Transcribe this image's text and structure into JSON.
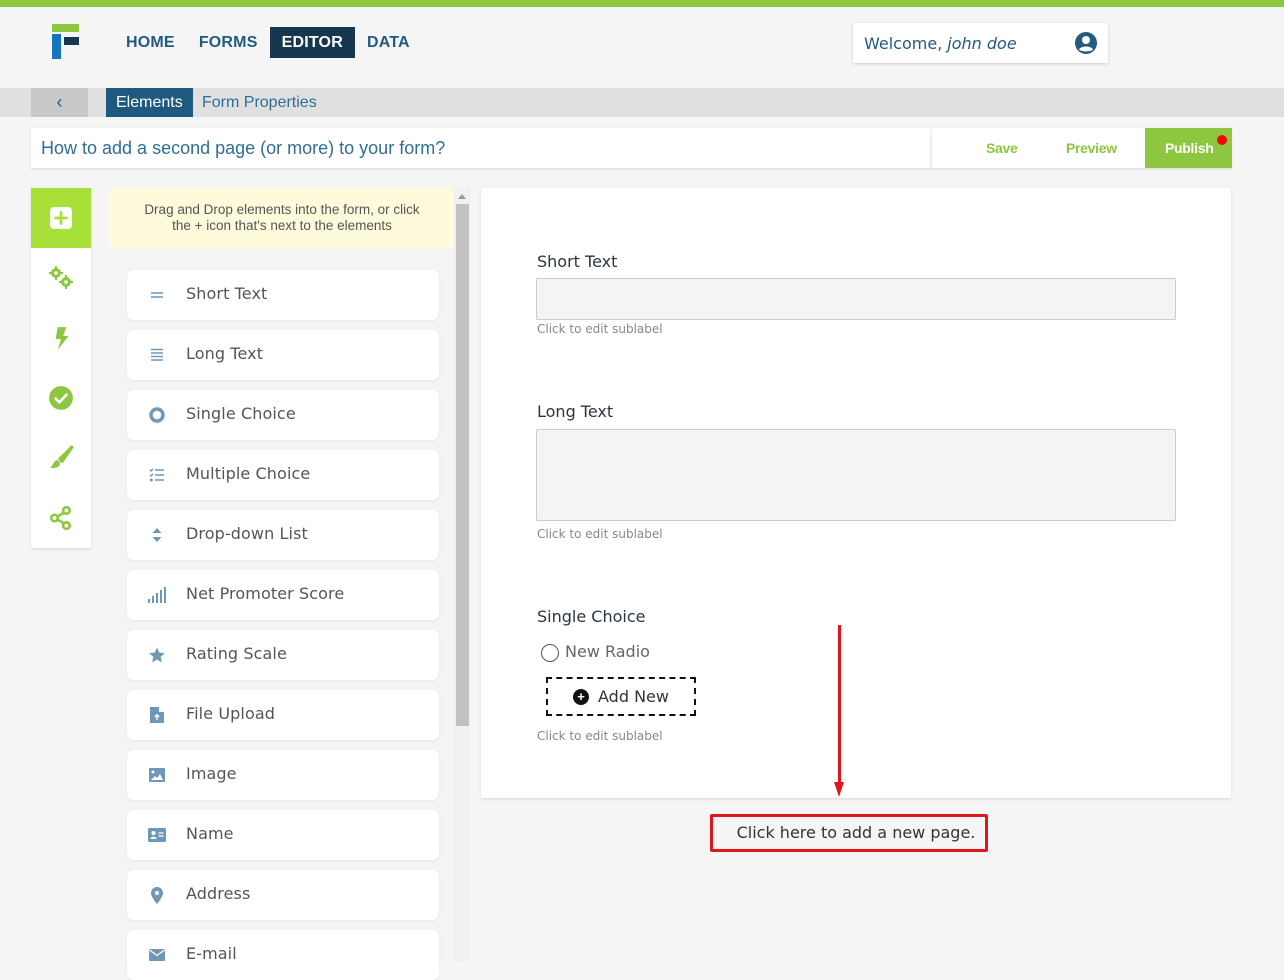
{
  "header": {
    "nav": [
      {
        "label": "HOME",
        "active": false
      },
      {
        "label": "FORMS",
        "active": false
      },
      {
        "label": "EDITOR",
        "active": true
      },
      {
        "label": "DATA",
        "active": false
      }
    ],
    "welcome_prefix": "Welcome,",
    "user_name": "john doe",
    "user_icon": "user-circle-icon"
  },
  "subnav": {
    "back_icon": "chevron-left-icon",
    "back_glyph": "‹",
    "tabs": [
      {
        "label": "Elements",
        "active": true
      },
      {
        "label": "Form Properties",
        "active": false
      }
    ]
  },
  "form": {
    "title": "How to add a second page (or more) to your form?"
  },
  "actions": {
    "save": "Save",
    "preview": "Preview",
    "publish": "Publish",
    "publish_has_notification": true
  },
  "sidebar": {
    "items": [
      {
        "icon": "plus-square-icon",
        "active": true
      },
      {
        "icon": "gears-icon",
        "active": false
      },
      {
        "icon": "bolt-icon",
        "active": false
      },
      {
        "icon": "check-circle-icon",
        "active": false
      },
      {
        "icon": "paintbrush-icon",
        "active": false
      },
      {
        "icon": "share-icon",
        "active": false
      }
    ]
  },
  "elements_panel": {
    "hint_line1": "Drag and Drop elements into the form, or click",
    "hint_line2": "the + icon that's next to the elements",
    "items": [
      {
        "label": "Short Text",
        "icon": "short-text-icon"
      },
      {
        "label": "Long Text",
        "icon": "long-text-icon"
      },
      {
        "label": "Single Choice",
        "icon": "radio-icon"
      },
      {
        "label": "Multiple Choice",
        "icon": "checklist-icon"
      },
      {
        "label": "Drop-down List",
        "icon": "sort-icon"
      },
      {
        "label": "Net Promoter Score",
        "icon": "signal-bars-icon"
      },
      {
        "label": "Rating Scale",
        "icon": "star-icon"
      },
      {
        "label": "File Upload",
        "icon": "file-upload-icon"
      },
      {
        "label": "Image",
        "icon": "image-icon"
      },
      {
        "label": "Name",
        "icon": "id-card-icon"
      },
      {
        "label": "Address",
        "icon": "map-marker-icon"
      },
      {
        "label": "E-mail",
        "icon": "envelope-icon"
      }
    ]
  },
  "canvas": {
    "fields": [
      {
        "label": "Short Text",
        "value": "",
        "sublabel": "Click to edit sublabel"
      },
      {
        "label": "Long Text",
        "value": "",
        "sublabel": "Click to edit sublabel"
      },
      {
        "label": "Single Choice",
        "options": [
          "New Radio"
        ],
        "add_new": "Add New",
        "sublabel": "Click to edit sublabel"
      }
    ]
  },
  "annotation": {
    "add_page_text": "Click here to add a new page.",
    "color": "#e0161c"
  },
  "colors": {
    "brand_green": "#8dc63f",
    "navy": "#15374f",
    "tab_blue": "#1e5a80",
    "icon_blue": "#6f97b6"
  }
}
